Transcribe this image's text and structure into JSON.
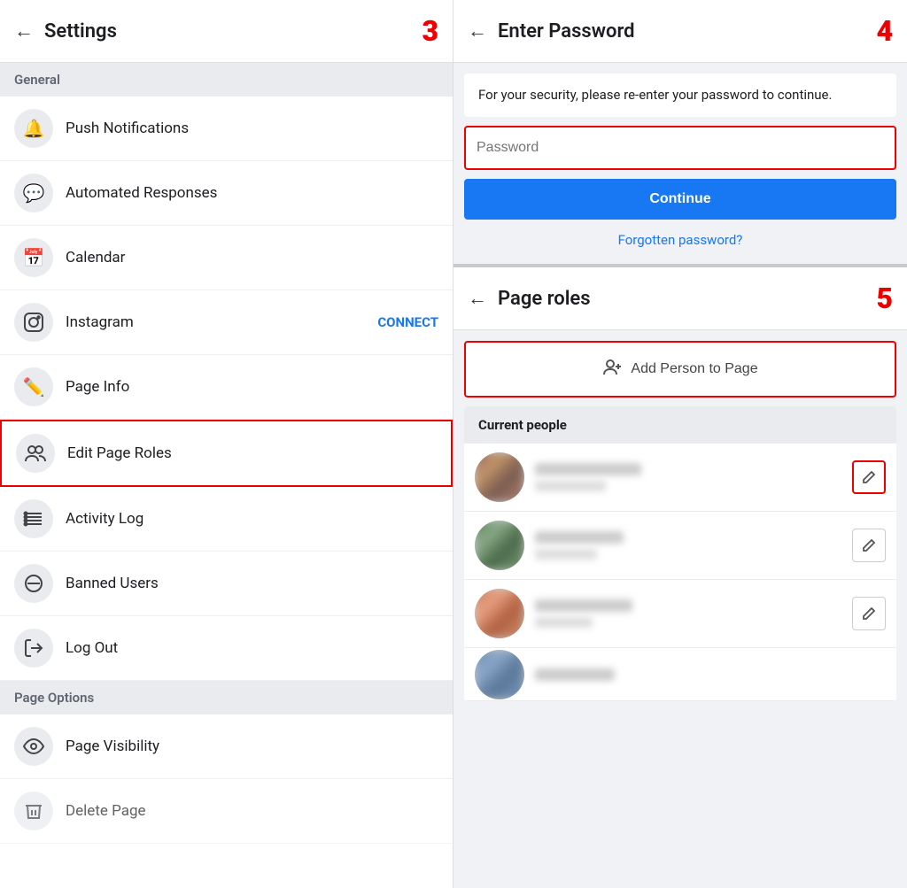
{
  "left": {
    "header": {
      "back_label": "←",
      "title": "Settings",
      "step": "3"
    },
    "general_section": "General",
    "menu_items": [
      {
        "id": "push-notifications",
        "icon": "🔔",
        "label": "Push Notifications",
        "badge": ""
      },
      {
        "id": "automated-responses",
        "icon": "💬",
        "label": "Automated Responses",
        "badge": ""
      },
      {
        "id": "calendar",
        "icon": "📅",
        "label": "Calendar",
        "badge": ""
      },
      {
        "id": "instagram",
        "icon": "📷",
        "label": "Instagram",
        "badge": "CONNECT"
      },
      {
        "id": "page-info",
        "icon": "✏️",
        "label": "Page Info",
        "badge": ""
      },
      {
        "id": "edit-page-roles",
        "icon": "👥",
        "label": "Edit Page Roles",
        "badge": "",
        "highlighted": true
      },
      {
        "id": "activity-log",
        "icon": "☰",
        "label": "Activity Log",
        "badge": ""
      },
      {
        "id": "banned-users",
        "icon": "⊖",
        "label": "Banned Users",
        "badge": ""
      },
      {
        "id": "log-out",
        "icon": "🚪",
        "label": "Log Out",
        "badge": ""
      }
    ],
    "page_options_section": "Page Options",
    "page_option_items": [
      {
        "id": "page-visibility",
        "icon": "👁",
        "label": "Page Visibility",
        "badge": ""
      },
      {
        "id": "delete-page",
        "icon": "🗑",
        "label": "Delete Page",
        "badge": ""
      }
    ]
  },
  "right": {
    "password_panel": {
      "header": {
        "back_label": "←",
        "title": "Enter Password",
        "step": "4"
      },
      "info_text": "For your security, please re-enter your password to continue.",
      "password_placeholder": "Password",
      "continue_label": "Continue",
      "forgotten_label": "Forgotten password?"
    },
    "roles_panel": {
      "header": {
        "back_label": "←",
        "title": "Page roles",
        "step": "5"
      },
      "add_person_label": "Add Person to Page",
      "current_people_header": "Current people",
      "people": [
        {
          "id": "person-1",
          "avatar_class": "person-avatar-1",
          "edit_highlighted": true
        },
        {
          "id": "person-2",
          "avatar_class": "person-avatar-2",
          "edit_highlighted": false
        },
        {
          "id": "person-3",
          "avatar_class": "person-avatar-3",
          "edit_highlighted": false
        },
        {
          "id": "person-4",
          "avatar_class": "person-avatar-4",
          "edit_highlighted": false
        }
      ]
    }
  }
}
